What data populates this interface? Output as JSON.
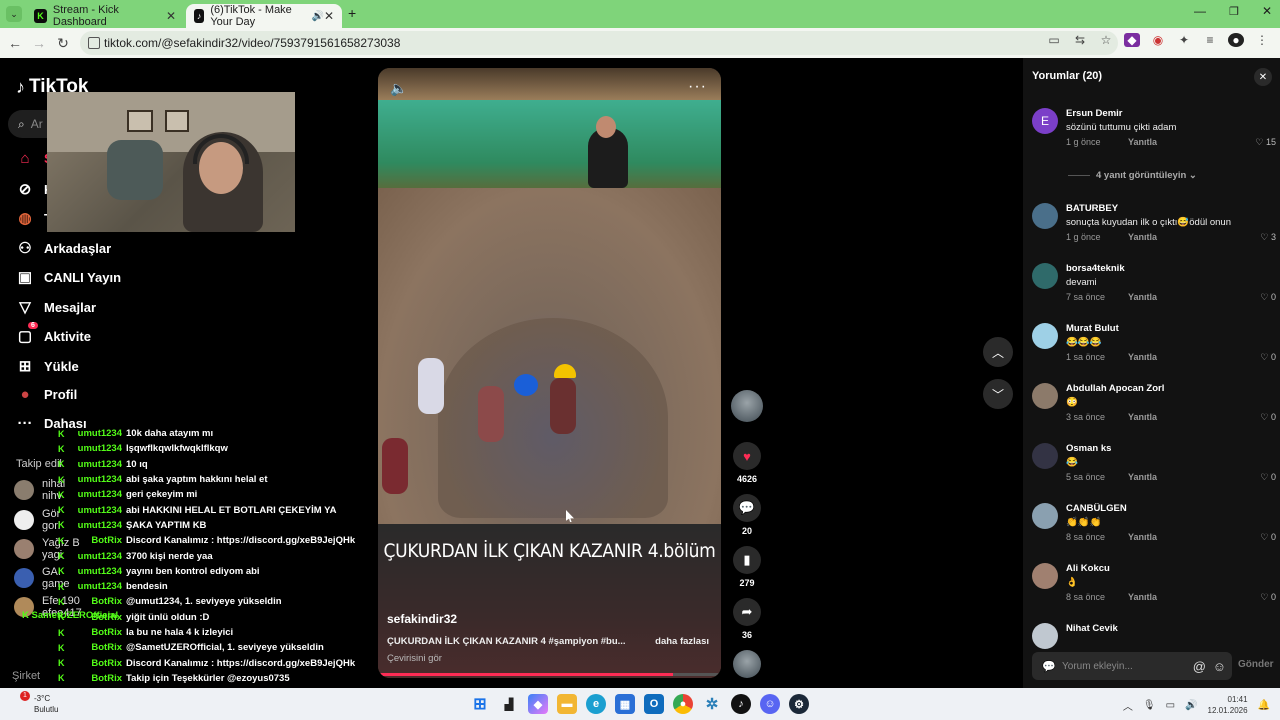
{
  "browser": {
    "tabs": [
      {
        "title": "Stream - Kick Dashboard",
        "active": false
      },
      {
        "title": "(6)TikTok - Make Your Day",
        "active": true
      }
    ],
    "url": "tiktok.com/@sefakindir32/video/7593791561658273038"
  },
  "sidebar": {
    "logo": "TikTok",
    "search_placeholder": "Ar",
    "nav": [
      {
        "label": "S",
        "icon": "home-icon"
      },
      {
        "label": "K",
        "icon": "compass-icon"
      },
      {
        "label": "T",
        "icon": "channel-icon"
      },
      {
        "label": "Arkadaşlar",
        "icon": "friends-icon"
      },
      {
        "label": "CANLI Yayın",
        "icon": "live-icon"
      },
      {
        "label": "Mesajlar",
        "icon": "messages-icon"
      },
      {
        "label": "Aktivite",
        "icon": "activity-icon",
        "badge": "6"
      },
      {
        "label": "Yükle",
        "icon": "upload-icon"
      },
      {
        "label": "Profil",
        "icon": "profile-icon"
      },
      {
        "label": "Dahası",
        "icon": "more-icon"
      }
    ],
    "following_header": "Takip edil",
    "following": [
      {
        "name": "nihal",
        "sub": "nihv"
      },
      {
        "name": "Gör",
        "sub": "gorl"
      },
      {
        "name": "Yağız B",
        "sub": "yagi"
      },
      {
        "name": "GAI",
        "sub": "game"
      },
      {
        "name": "Efe 190",
        "sub": "efee417"
      }
    ],
    "footer": "Şirket"
  },
  "chat": [
    {
      "user": "umut1234",
      "msg": "10k daha atayım mı"
    },
    {
      "user": "umut1234",
      "msg": "lşqwflkqwlkfwqklflkqw"
    },
    {
      "user": "umut1234",
      "msg": "10 ıq"
    },
    {
      "user": "umut1234",
      "msg": "abi şaka yaptım hakkını helal et"
    },
    {
      "user": "umut1234",
      "msg": "geri çekeyim mi"
    },
    {
      "user": "umut1234",
      "msg": "abi HAKKINI HELAL ET BOTLARI ÇEKEYİM YA"
    },
    {
      "user": "umut1234",
      "msg": "ŞAKA YAPTIM KB"
    },
    {
      "user": "BotRix",
      "msg": "Discord Kanalımız : https://discord.gg/xeB9JejQHk"
    },
    {
      "user": "umut1234",
      "msg": "3700 kişi nerde yaa"
    },
    {
      "user": "umut1234",
      "msg": "yayını ben kontrol ediyom abi"
    },
    {
      "user": "umut1234",
      "msg": "bendesin"
    },
    {
      "user": "BotRix",
      "msg": "@umut1234, 1. seviyeye yükseldin"
    },
    {
      "user": "BotRix",
      "msg": "yiğit ünlü oldun :D"
    },
    {
      "user": "BotRix",
      "msg": "la bu ne hala 4 k izleyici"
    },
    {
      "user": "BotRix",
      "msg": "@SametUZEROfficial, 1. seviyeye yükseldin"
    },
    {
      "user": "BotRix",
      "msg": "Discord Kanalımız : https://discord.gg/xeB9JejQHk"
    },
    {
      "user": "BotRix",
      "msg": "Takip için Teşekkürler @ezoyus0735"
    }
  ],
  "chat_extra_user": "SametUZEROfficial",
  "video": {
    "title": "ÇUKURDAN İLK ÇIKAN KAZANIR 4.bölüm",
    "author": "sefakindir32",
    "description": "ÇUKURDAN İLK ÇIKAN KAZANIR 4 #şampiyon #bu...",
    "more": "daha fazlası",
    "translate": "Çevirisini gör",
    "progress": 0.86
  },
  "actions": {
    "likes": "4626",
    "comments": "20",
    "saves": "279",
    "shares": "36"
  },
  "comments": {
    "header": "Yorumlar (20)",
    "view_replies": "4 yanıt görüntüleyin",
    "input_placeholder": "Yorum ekleyin...",
    "send": "Gönder",
    "reply_label": "Yanıtla",
    "items": [
      {
        "name": "Ersun Demir",
        "text": "sözünü tuttumu çikti adam",
        "time": "1 g önce",
        "likes": "15",
        "avatar_color": "#7b3fc8",
        "initial": "E"
      },
      {
        "name": "BATURBEY",
        "text": "sonuçta kuyudan ilk o çıktı😅ödül onun",
        "time": "1 g önce",
        "likes": "3",
        "avatar_color": "#4a6f8a",
        "initial": ""
      },
      {
        "name": "borsa4teknik",
        "text": "devami",
        "time": "7 sa önce",
        "likes": "0",
        "avatar_color": "#2f6a6a",
        "initial": ""
      },
      {
        "name": "Murat Bulut",
        "text": "😂😂😂",
        "time": "1 sa önce",
        "likes": "0",
        "avatar_color": "#9ed0e6",
        "initial": ""
      },
      {
        "name": "Abdullah Apocan Zorl",
        "text": "😳",
        "time": "3 sa önce",
        "likes": "0",
        "avatar_color": "#8c7a6a",
        "initial": ""
      },
      {
        "name": "Osman ks",
        "text": "😂",
        "time": "5 sa önce",
        "likes": "0",
        "avatar_color": "#333344",
        "initial": ""
      },
      {
        "name": "CANBÜLGEN",
        "text": "👏👏👏",
        "time": "8 sa önce",
        "likes": "0",
        "avatar_color": "#8aa0b0",
        "initial": ""
      },
      {
        "name": "Ali Kokcu",
        "text": "👌",
        "time": "8 sa önce",
        "likes": "0",
        "avatar_color": "#a08070",
        "initial": ""
      },
      {
        "name": "Nihat Cevik",
        "text": "",
        "time": "",
        "likes": "",
        "avatar_color": "#c0c8d0",
        "initial": ""
      }
    ]
  },
  "taskbar": {
    "weather_temp": "-3°C",
    "weather_desc": "Bulutlu",
    "notification_count": "1",
    "time": "01:41",
    "date": "12.01.2026"
  }
}
